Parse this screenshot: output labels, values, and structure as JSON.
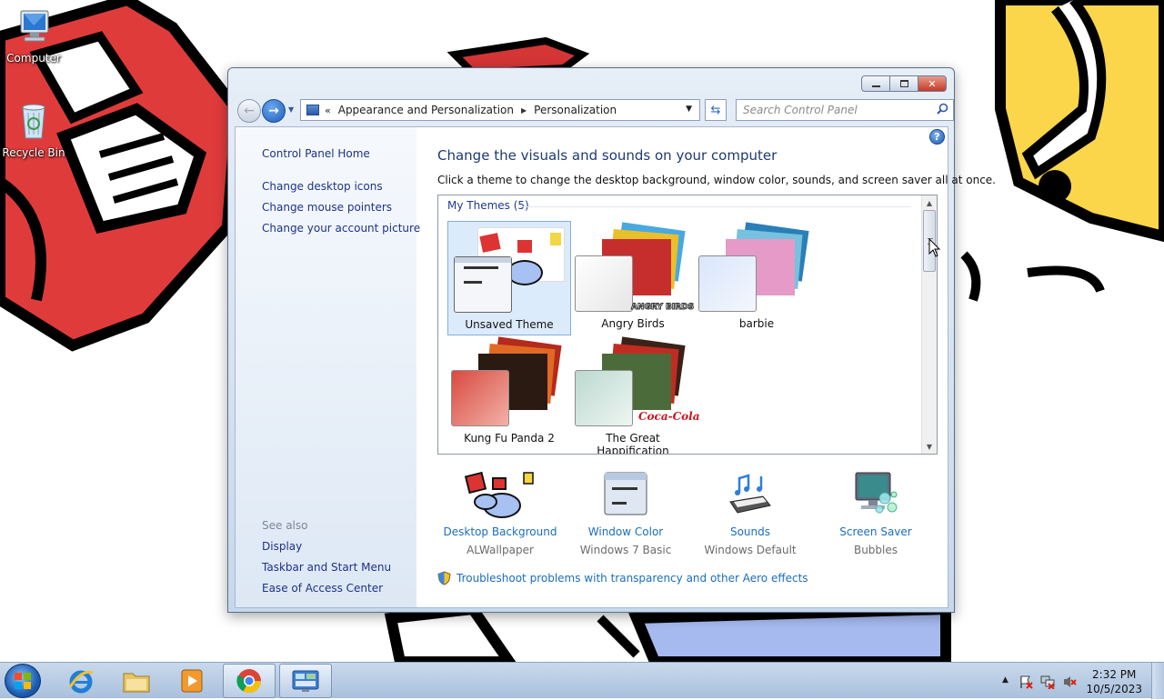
{
  "desktop": {
    "icons": [
      {
        "label": "Computer",
        "icon": "computer-icon"
      },
      {
        "label": "Recycle Bin",
        "icon": "recycle-bin-icon"
      }
    ]
  },
  "window": {
    "caption_buttons": {
      "minimize": "minimize-icon",
      "maximize": "maximize-icon",
      "close": "close-icon"
    },
    "breadcrumb": {
      "prefix": "«",
      "items": [
        "Appearance and Personalization",
        "Personalization"
      ]
    },
    "search": {
      "placeholder": "Search Control Panel"
    },
    "sidebar": {
      "home": "Control Panel Home",
      "links": [
        "Change desktop icons",
        "Change mouse pointers",
        "Change your account picture"
      ],
      "see_also_label": "See also",
      "see_also": [
        "Display",
        "Taskbar and Start Menu",
        "Ease of Access Center"
      ]
    },
    "main": {
      "title": "Change the visuals and sounds on your computer",
      "description": "Click a theme to change the desktop background, window color, sounds, and screen saver all at once.",
      "themes_header": "My Themes (5)",
      "themes": [
        {
          "name": "Unsaved Theme",
          "selected": true
        },
        {
          "name": "Angry Birds",
          "badge": "ANGRY BIRDS"
        },
        {
          "name": "barbie"
        },
        {
          "name": "Kung Fu Panda 2"
        },
        {
          "name": "The Great Happification",
          "badge": "Coca-Cola"
        }
      ],
      "options": [
        {
          "label": "Desktop Background",
          "sub": "ALWallpaper",
          "icon": "desktop-background-icon"
        },
        {
          "label": "Window Color",
          "sub": "Windows 7 Basic",
          "icon": "window-color-icon"
        },
        {
          "label": "Sounds",
          "sub": "Windows Default",
          "icon": "sounds-icon"
        },
        {
          "label": "Screen Saver",
          "sub": "Bubbles",
          "icon": "screen-saver-icon"
        }
      ],
      "troubleshoot": "Troubleshoot problems with transparency and other Aero effects"
    }
  },
  "taskbar": {
    "pinned": [
      "internet-explorer-icon",
      "file-explorer-icon",
      "media-player-icon",
      "chrome-icon",
      "control-panel-icon"
    ],
    "clock_time": "2:32 PM",
    "clock_date": "10/5/2023"
  },
  "colors": {
    "link": "#1a6ebd",
    "title": "#1e3a6e",
    "selection": "#dcebfc"
  }
}
